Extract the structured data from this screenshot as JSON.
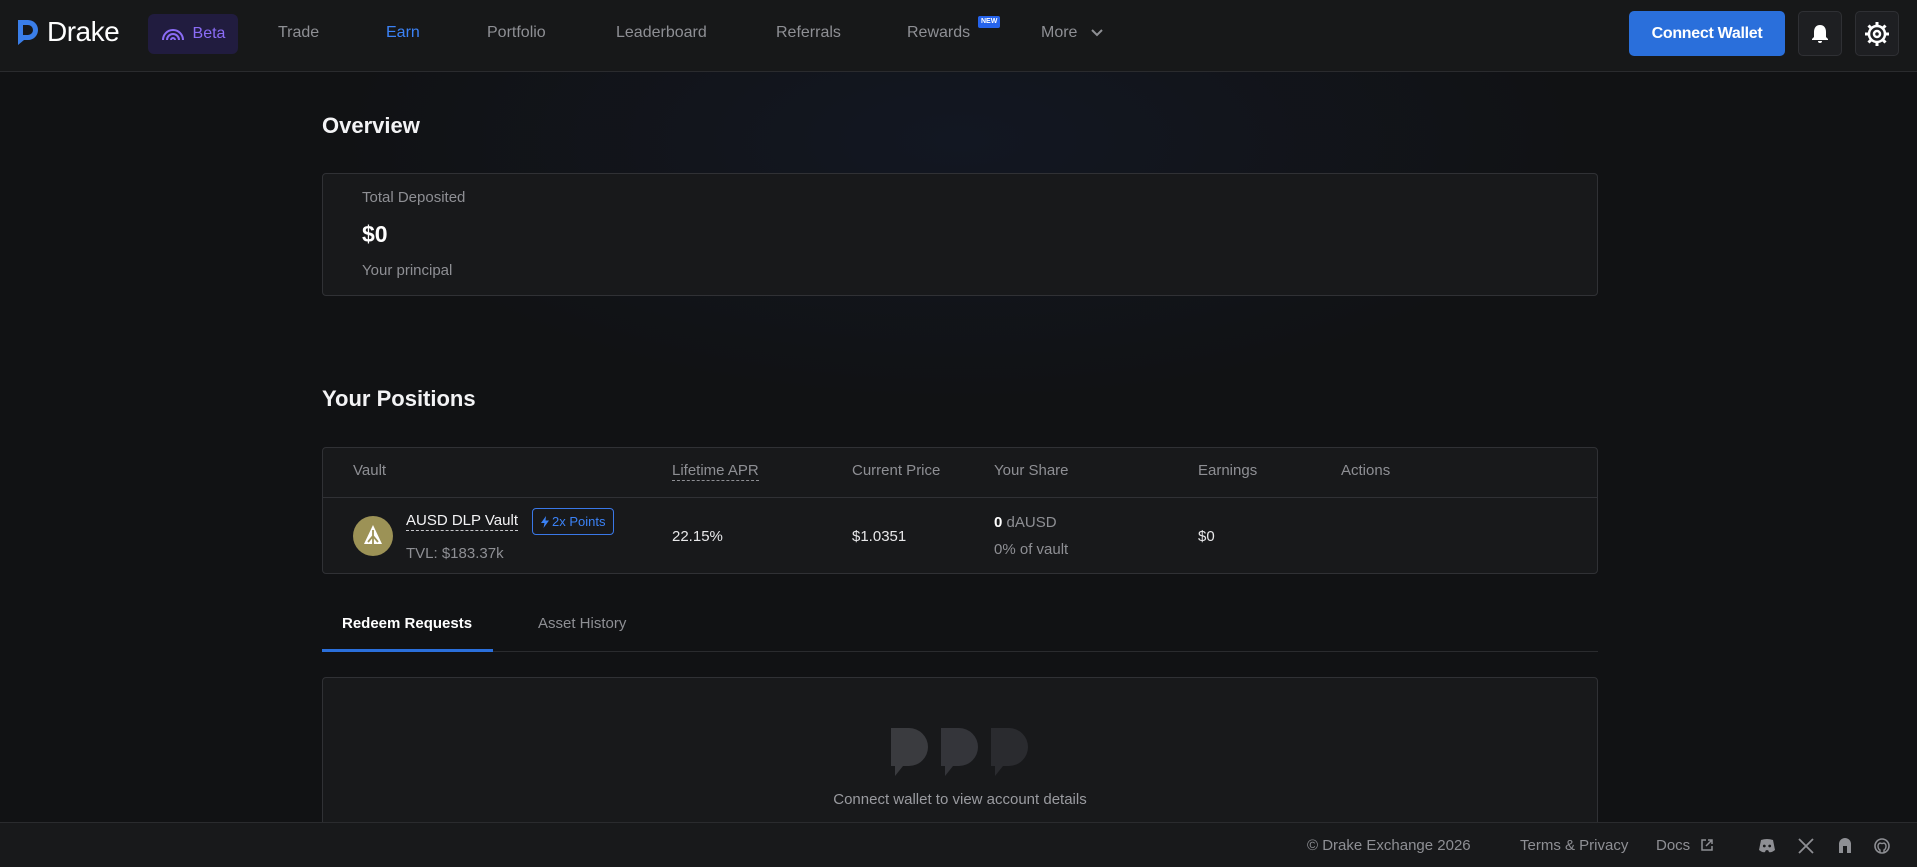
{
  "brand": {
    "name": "Drake",
    "beta_label": "Beta"
  },
  "nav": {
    "trade": "Trade",
    "earn": "Earn",
    "portfolio": "Portfolio",
    "leaderboard": "Leaderboard",
    "referrals": "Referrals",
    "rewards": "Rewards",
    "rewards_badge": "NEW",
    "more": "More"
  },
  "header": {
    "connect_wallet": "Connect Wallet"
  },
  "overview": {
    "title": "Overview",
    "total_deposited_label": "Total Deposited",
    "total_deposited_value": "$0",
    "subtitle": "Your principal"
  },
  "positions": {
    "title": "Your Positions",
    "columns": [
      "Vault",
      "Lifetime APR",
      "Current Price",
      "Your Share",
      "Earnings",
      "Actions"
    ],
    "rows": [
      {
        "vault_name": "AUSD DLP Vault",
        "points_badge": "2x Points",
        "tvl": "TVL: $183.37k",
        "lifetime_apr": "22.15%",
        "current_price": "$1.0351",
        "share_amount": "0",
        "share_unit": "dAUSD",
        "share_pct": "0% of vault",
        "earnings": "$0"
      }
    ]
  },
  "tabs": {
    "redeem": "Redeem Requests",
    "history": "Asset History"
  },
  "empty_state": {
    "message": "Connect wallet to view account details"
  },
  "footer": {
    "copyright": "© Drake Exchange 2026",
    "terms": "Terms & Privacy",
    "docs": "Docs"
  },
  "colors": {
    "accent": "#2a6fdb",
    "beta": "#8b6cf6",
    "vault_icon": "#9c9256"
  },
  "icons": [
    "drake-logo",
    "beta-signal",
    "chevron-down",
    "bell",
    "gear",
    "bolt",
    "external-link",
    "discord",
    "x-twitter",
    "mirror",
    "github"
  ]
}
